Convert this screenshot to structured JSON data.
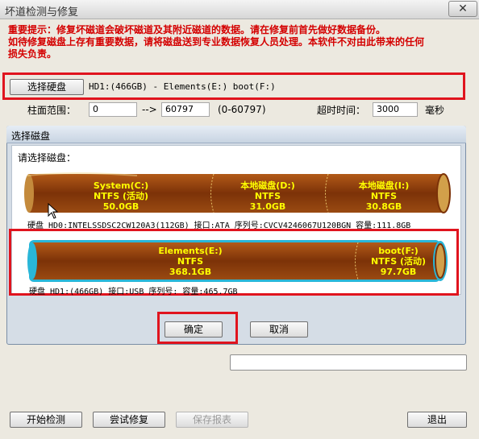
{
  "window": {
    "title": "坏道检测与修复",
    "close_glyph": "✕"
  },
  "warning": {
    "lines": [
      "重要提示：修复坏磁道会破坏磁道及其附近磁道的数据。请在修复前首先做好数据备份。",
      "如待修复磁盘上存有重要数据，请将磁盘送到专业数据恢复人员处理。本软件不对由此带来的任何",
      "损失负责。"
    ]
  },
  "disk_select": {
    "button_label": "选择硬盘",
    "selected_disk": "HD1:(466GB) - Elements(E:) boot(F:)"
  },
  "cylinder": {
    "label": "柱面范围：",
    "start": "0",
    "arrow": "-->",
    "end": "60797",
    "range": "(0-60797)"
  },
  "timeout": {
    "label": "超时时间：",
    "value": "3000",
    "unit": "毫秒"
  },
  "dialog": {
    "title": "选择磁盘",
    "prompt": "请选择磁盘：",
    "disk0": {
      "partitions": [
        {
          "name": "System(C:)",
          "fs": "NTFS (活动)",
          "size": "50.0GB"
        },
        {
          "name": "本地磁盘(D:)",
          "fs": "NTFS",
          "size": "31.0GB"
        },
        {
          "name": "本地磁盘(I:)",
          "fs": "NTFS",
          "size": "30.8GB"
        }
      ],
      "info": "硬盘 HD0:INTELSSDSC2CW120A3(112GB)   接口:ATA  序列号:CVCV4246067U120BGN  容量:111.8GB"
    },
    "disk1": {
      "partitions": [
        {
          "name": "Elements(E:)",
          "fs": "NTFS",
          "size": "368.1GB"
        },
        {
          "name": "boot(F:)",
          "fs": "NTFS (活动)",
          "size": "97.7GB"
        }
      ],
      "info": "硬盘 HD1:(466GB)   接口:USB  序列号:  容量:465.7GB"
    },
    "ok_label": "确定",
    "cancel_label": "取消"
  },
  "bottom": {
    "start_label": "开始检测",
    "repair_label": "尝试修复",
    "save_label": "保存报表",
    "exit_label": "退出"
  },
  "colors": {
    "warning": "#d40000",
    "highlight_box": "#e0141e",
    "disk_fill": "#8a3a0c",
    "disk_text": "#ffff00",
    "selected_outline": "#29b6d8"
  }
}
